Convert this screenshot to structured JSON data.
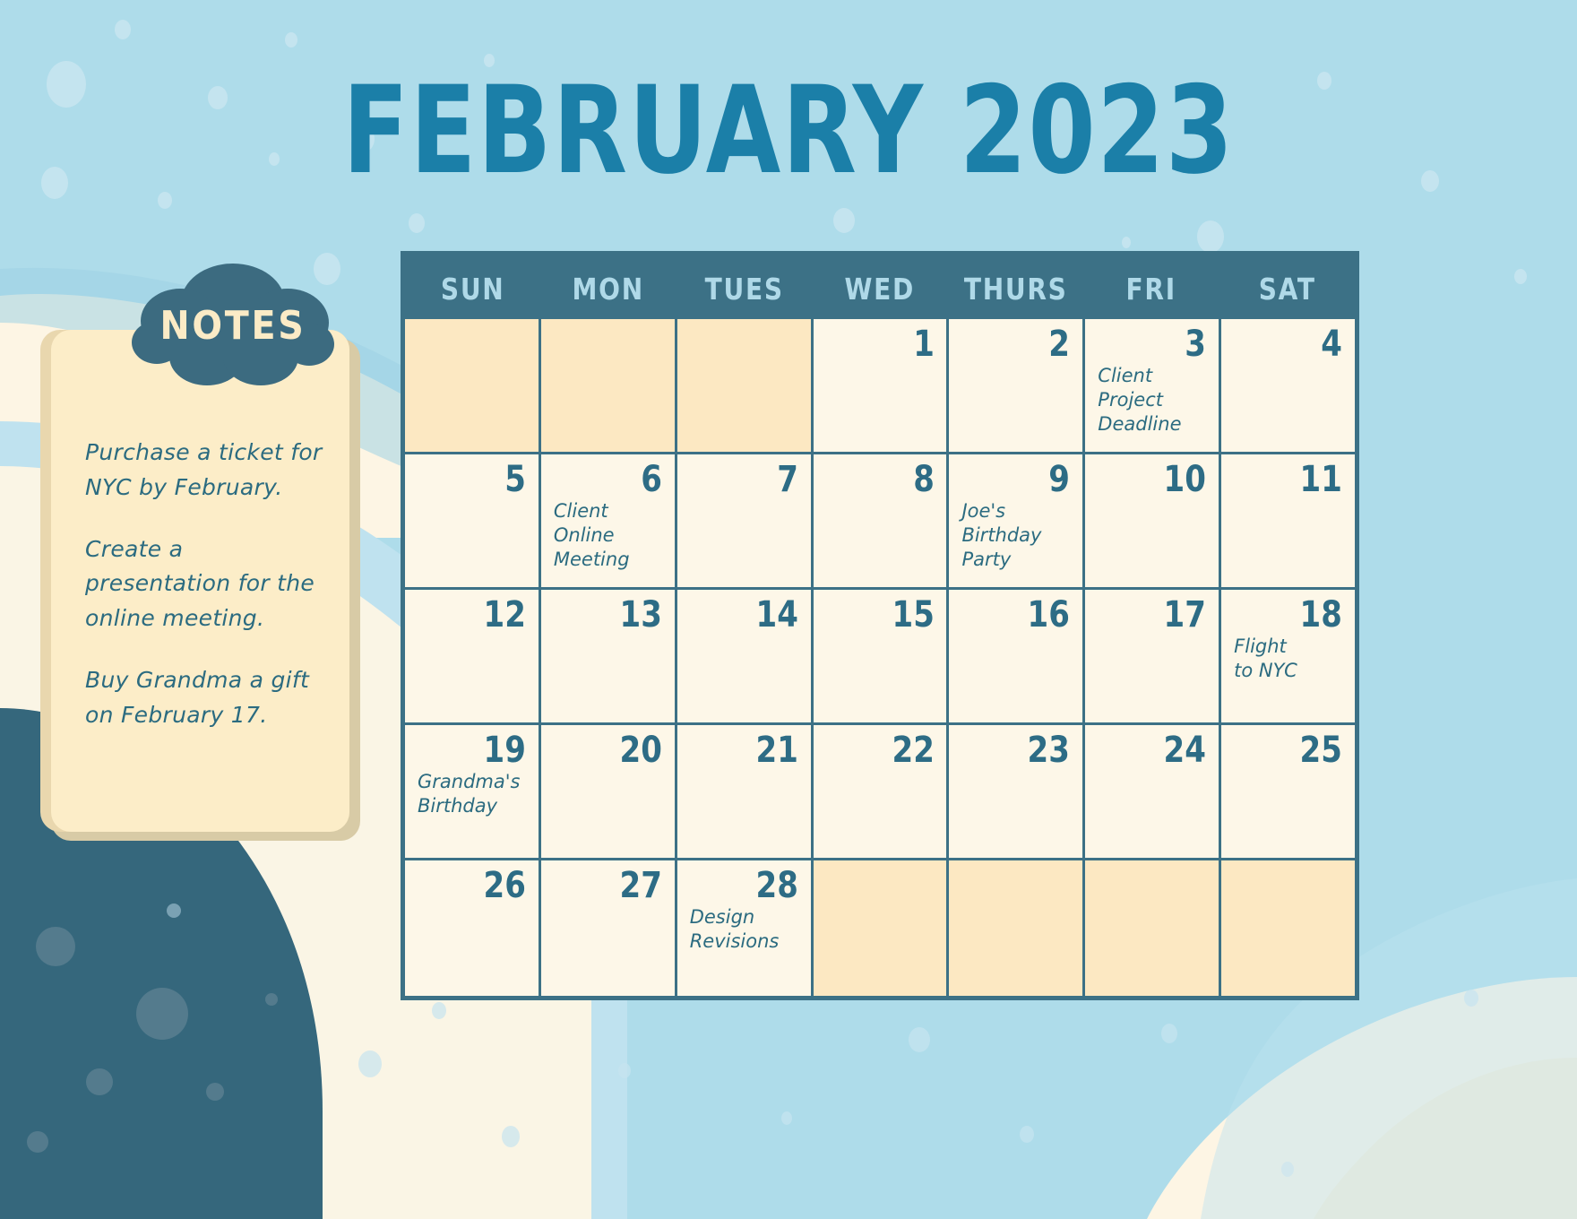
{
  "title": "FEBRUARY 2023",
  "colors": {
    "background": "#AEDCEA",
    "title": "#1B7FA8",
    "teal": "#3C7186",
    "cream_active": "#FDF7E8",
    "cream_muted": "#FCE8C2",
    "note_card": "#FCEDC8",
    "script_text": "#2B6B80",
    "dayname": "#AFD9E8"
  },
  "notes": {
    "heading": "NOTES",
    "lines": [
      "Purchase a ticket for NYC by February.",
      "Create a presentation for the online meeting.",
      "Buy Grandma a gift on February 17."
    ]
  },
  "calendar": {
    "daynames": [
      "SUN",
      "MON",
      "TUES",
      "WED",
      "THURS",
      "FRI",
      "SAT"
    ],
    "weeks": [
      [
        {
          "day": "",
          "event": "",
          "muted": true
        },
        {
          "day": "",
          "event": "",
          "muted": true
        },
        {
          "day": "",
          "event": "",
          "muted": true
        },
        {
          "day": "1",
          "event": "",
          "muted": false
        },
        {
          "day": "2",
          "event": "",
          "muted": false
        },
        {
          "day": "3",
          "event": "Client\nProject\nDeadline",
          "muted": false
        },
        {
          "day": "4",
          "event": "",
          "muted": false
        }
      ],
      [
        {
          "day": "5",
          "event": "",
          "muted": false
        },
        {
          "day": "6",
          "event": "Client\nOnline\nMeeting",
          "muted": false
        },
        {
          "day": "7",
          "event": "",
          "muted": false
        },
        {
          "day": "8",
          "event": "",
          "muted": false
        },
        {
          "day": "9",
          "event": "Joe's\nBirthday\nParty",
          "muted": false
        },
        {
          "day": "10",
          "event": "",
          "muted": false
        },
        {
          "day": "11",
          "event": "",
          "muted": false
        }
      ],
      [
        {
          "day": "12",
          "event": "",
          "muted": false
        },
        {
          "day": "13",
          "event": "",
          "muted": false
        },
        {
          "day": "14",
          "event": "",
          "muted": false
        },
        {
          "day": "15",
          "event": "",
          "muted": false
        },
        {
          "day": "16",
          "event": "",
          "muted": false
        },
        {
          "day": "17",
          "event": "",
          "muted": false
        },
        {
          "day": "18",
          "event": "Flight\nto NYC",
          "muted": false
        }
      ],
      [
        {
          "day": "19",
          "event": "Grandma's\nBirthday",
          "muted": false
        },
        {
          "day": "20",
          "event": "",
          "muted": false
        },
        {
          "day": "21",
          "event": "",
          "muted": false
        },
        {
          "day": "22",
          "event": "",
          "muted": false
        },
        {
          "day": "23",
          "event": "",
          "muted": false
        },
        {
          "day": "24",
          "event": "",
          "muted": false
        },
        {
          "day": "25",
          "event": "",
          "muted": false
        }
      ],
      [
        {
          "day": "26",
          "event": "",
          "muted": false
        },
        {
          "day": "27",
          "event": "",
          "muted": false
        },
        {
          "day": "28",
          "event": "Design\nRevisions",
          "muted": false
        },
        {
          "day": "",
          "event": "",
          "muted": true
        },
        {
          "day": "",
          "event": "",
          "muted": true
        },
        {
          "day": "",
          "event": "",
          "muted": true
        },
        {
          "day": "",
          "event": "",
          "muted": true
        }
      ]
    ]
  }
}
